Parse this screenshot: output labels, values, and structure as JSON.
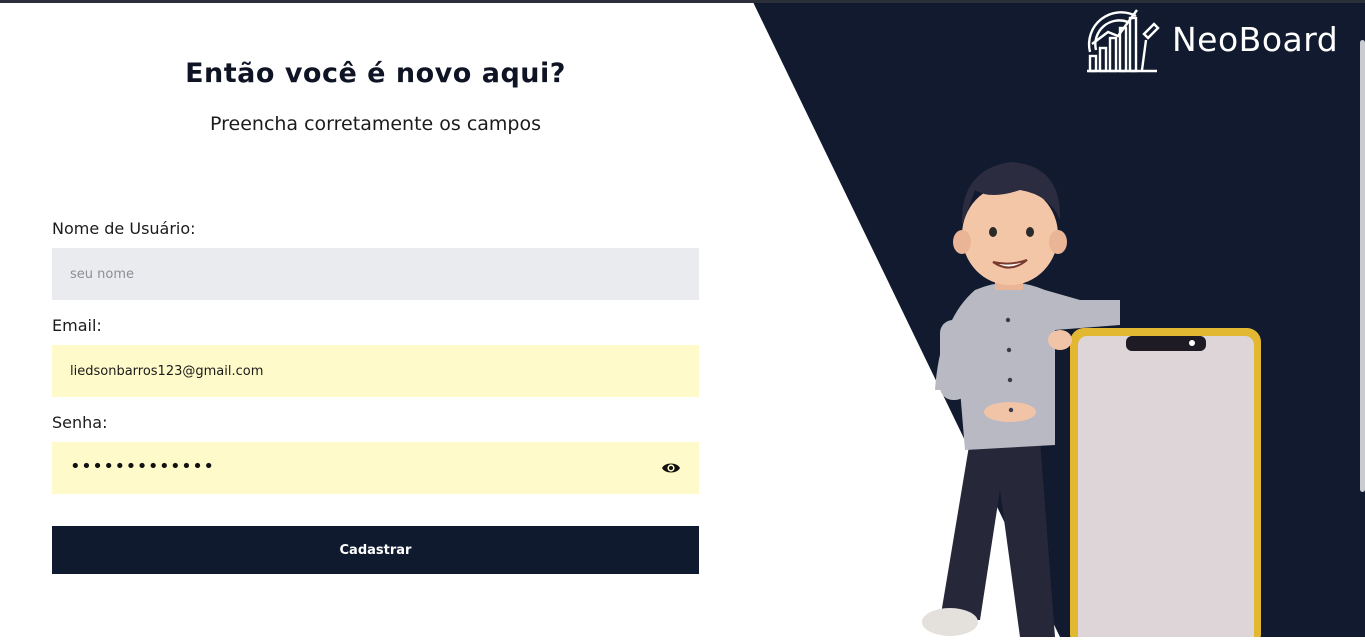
{
  "form": {
    "title": "Então você é novo aqui?",
    "subtitle": "Preencha corretamente os campos",
    "username": {
      "label": "Nome de Usuário:",
      "placeholder": "seu nome",
      "value": ""
    },
    "email": {
      "label": "Email:",
      "value": "liedsonbarros123@gmail.com"
    },
    "password": {
      "label": "Senha:",
      "masked_value": "•••••••••••••",
      "toggle_icon": "eye-icon"
    },
    "submit_label": "Cadastrar"
  },
  "brand": {
    "name": "NeoBoard",
    "logo_icon": "chart-growth-icon"
  },
  "colors": {
    "dark_navy": "#111a2e",
    "button": "#0f1a2e",
    "input_gray": "#eaebef",
    "input_autofill": "#fefac9",
    "phone_frame": "#e2b731"
  }
}
